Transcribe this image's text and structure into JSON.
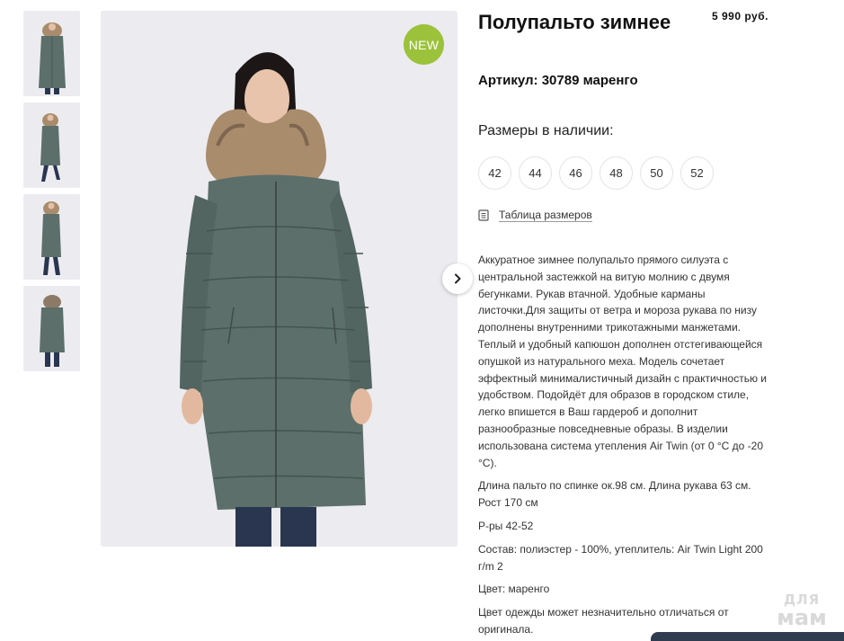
{
  "product": {
    "title": "Полупальто зимнее",
    "price": "5 990 руб.",
    "sku": "Артикул: 30789 маренго",
    "badge": "NEW"
  },
  "sizes": {
    "title": "Размеры в наличии:",
    "items": [
      "42",
      "44",
      "46",
      "48",
      "50",
      "52"
    ],
    "table_link": "Таблица размеров"
  },
  "description": [
    "Аккуратное зимнее полупальто прямого силуэта с центральной застежкой на витую молнию с двумя бегунками. Рукав втачной. Удобные карманы листочки.Для защиты от ветра и мороза рукава по низу дополнены внутренними трикотажными манжетами. Теплый и удобный капюшон дополнен отстегивающейся опушкой из натурального меха. Модель сочетает эффектный минималистичный дизайн с практичностью и удобством. Подойдёт для образов в городском стиле, легко впишется в Ваш гардероб и дополнит разнообразные повседневные образы. В изделии использована система утепления Air Twin (от 0 °C до -20 °C).",
    "Длина пальто по спинке ок.98 см. Длина рукава 63 см. Рост 170 см",
    "Р-ры 42-52",
    "Состав: полиэстер - 100%, утеплитель: Air Twin Light 200 г/m 2",
    "Цвет: маренго",
    "Цвет одежды может незначительно отличаться от оригинала."
  ],
  "watermark": {
    "line1": "ДЛЯ",
    "line2": "мам"
  },
  "icons": {
    "next": "chevron-right-icon",
    "size_table": "document-icon"
  },
  "colors": {
    "badge": "#9bc23a",
    "coat": "#5c6f6a",
    "fur": "#a98c6c",
    "photo_bg": "#ecebef"
  }
}
